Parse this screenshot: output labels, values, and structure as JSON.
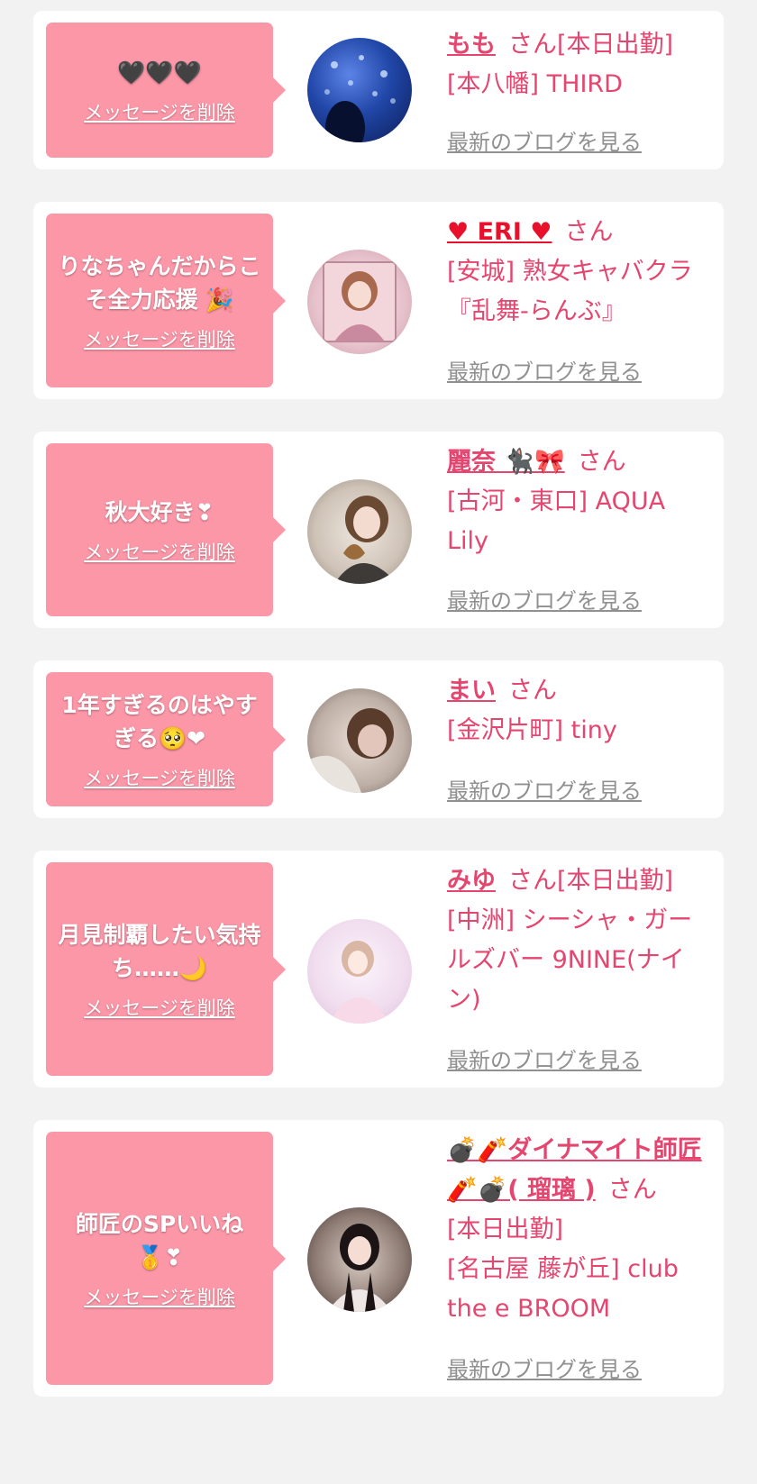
{
  "delete_label": "メッセージを削除",
  "blog_label": "最新のブログを見る",
  "san_label": "さん",
  "colors": {
    "bubble": "#fc97a8",
    "accent": "#e4466f",
    "heart": "#e8102a",
    "link_gray": "#909090",
    "background": "#f2f2f2"
  },
  "cards": [
    {
      "message": "🖤🖤🖤",
      "name": "もも",
      "status": "[本日出勤]",
      "shop": "[本八幡] THIRD"
    },
    {
      "message": "りなちゃんだからこそ全力応援 🎉",
      "name": "♥ ERI ♥",
      "status": "",
      "shop": "[安城] 熟女キャバクラ『乱舞-らんぶ』"
    },
    {
      "message": "秋大好き❣",
      "name": "麗奈 🐈‍⬛🎀",
      "status": "",
      "shop": "[古河・東口] AQUA Lily"
    },
    {
      "message": "1年すぎるのはやすぎる🥺❤",
      "name": "まい",
      "status": "",
      "shop": "[金沢片町] tiny"
    },
    {
      "message": "月見制覇したい気持ち……🌙",
      "name": "みゆ",
      "status": "[本日出勤]",
      "shop": "[中洲] シーシャ・ガールズバー 9NINE(ナイン)"
    },
    {
      "message": "師匠のSPいいね🥇❣",
      "name": "💣🧨ダイナマイト師匠🧨💣( 瑠璃 )",
      "status": "[本日出勤]",
      "shop": "[名古屋 藤が丘] club the e BROOM"
    }
  ]
}
